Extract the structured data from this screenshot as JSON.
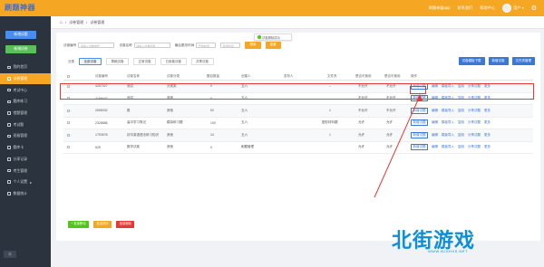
{
  "header": {
    "logo_text": "刷题神器",
    "links": [
      "刷题神器app",
      "联系我们",
      "帮助中心"
    ],
    "user_name": "用户"
  },
  "sidebar": {
    "btn1": "新增试题",
    "btn2": "新增试卷",
    "items": [
      {
        "label": "我的首页",
        "active": false
      },
      {
        "label": "试卷管理",
        "active": true
      },
      {
        "label": "考试中心",
        "active": false
      },
      {
        "label": "题库练习",
        "active": false
      },
      {
        "label": "错题管理",
        "active": false
      },
      {
        "label": "考试题",
        "active": false
      },
      {
        "label": "班级管理",
        "active": false
      },
      {
        "label": "题库卡",
        "active": false
      },
      {
        "label": "分享记录",
        "active": false
      },
      {
        "label": "考生管理",
        "active": false
      },
      {
        "label": "个人设置",
        "active": false
      },
      {
        "label": "数据统计",
        "active": false
      }
    ],
    "collapse_label": "收"
  },
  "breadcrumb": [
    "试卷管理",
    "试卷管理"
  ],
  "toast": "试卷删除成功",
  "filters": {
    "name_label": "试卷编号",
    "name_placeholder": "请输入试卷编号",
    "title_label": "试卷名称",
    "title_placeholder": "请输入试卷名称",
    "time_label": "最后更改时间",
    "time_placeholder": "开始时间",
    "time_placeholder2": "结束时间",
    "search_btn": "搜索",
    "reset_btn": "重置"
  },
  "categories": {
    "label": "分类",
    "tabs": [
      "全部试卷",
      "草稿试卷",
      "正常试卷",
      "已用卷试卷",
      "共享试卷"
    ]
  },
  "action_buttons": [
    "试卷模板下载",
    "新增试卷",
    "文件夹管理"
  ],
  "table": {
    "headers": [
      "试卷编号",
      "试卷名称",
      "试卷分类",
      "题目数量",
      "创建人",
      "发布人",
      "文件夹",
      "是否可使用",
      "是否可使用",
      "操作"
    ],
    "rows": [
      [
        "4257027",
        "测试",
        "分类类",
        "0",
        "五六",
        "",
        "--",
        "不允许",
        "不允许"
      ],
      [
        "4169447",
        "测试",
        "其他",
        "0",
        "五六",
        "",
        "--",
        "不允许",
        "不允许"
      ],
      [
        "2658332",
        "数",
        "其他",
        "52",
        "五六",
        "",
        "1",
        "不允许",
        "不允许"
      ],
      [
        "2328886",
        "高中学习笔记",
        "模拟练习题",
        "100",
        "五六",
        "",
        "图形材料题",
        "允许",
        "允许"
      ],
      [
        "1753578",
        "初中英语语法练习知识",
        "其他",
        "24",
        "五六",
        "",
        "1",
        "允许",
        "允许"
      ],
      [
        "625",
        "数学试卷",
        "其他",
        "0",
        "刷题管理",
        "",
        "",
        "允许",
        "允许"
      ]
    ],
    "ops": [
      "新增试题",
      "编辑",
      "模板导入",
      "复制",
      "分享试题",
      "更多"
    ]
  },
  "footer_buttons": [
    "+ 批量移动",
    "批量排序",
    "批量删除"
  ],
  "watermark": {
    "text": "北街游戏",
    "url": "WWW.BJXHXS.NET"
  },
  "colors": {
    "accent": "#f5a623",
    "sidebar": "#2b333e",
    "link": "#3a78d8",
    "highlight": "#e53935"
  }
}
